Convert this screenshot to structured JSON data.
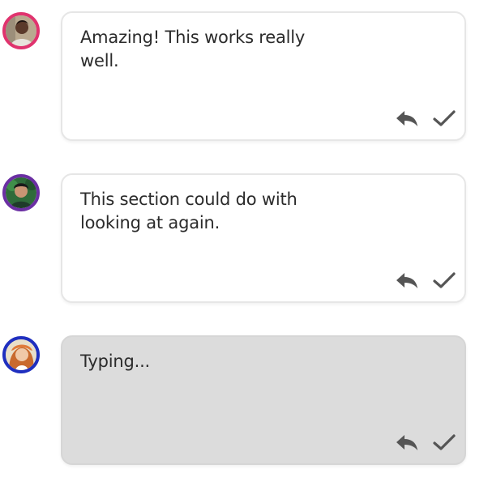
{
  "comments": [
    {
      "text": "Amazing! This works really well.",
      "avatar_icon": "person-avatar-icon",
      "avatar_ring": "#e0336e",
      "state": "posted"
    },
    {
      "text": "This section could do with looking at again.",
      "avatar_icon": "person-avatar-icon",
      "avatar_ring": "#6b2fa3",
      "state": "posted"
    },
    {
      "text": "Typing...",
      "avatar_icon": "person-avatar-icon",
      "avatar_ring": "#1f2fbf",
      "state": "typing"
    }
  ],
  "actions": {
    "reply_icon": "reply-icon",
    "resolve_icon": "checkmark-icon"
  },
  "colors": {
    "bubble_bg": "#ffffff",
    "typing_bg": "#dcdcdc",
    "icon": "#555555",
    "text": "#2b2b2b"
  }
}
